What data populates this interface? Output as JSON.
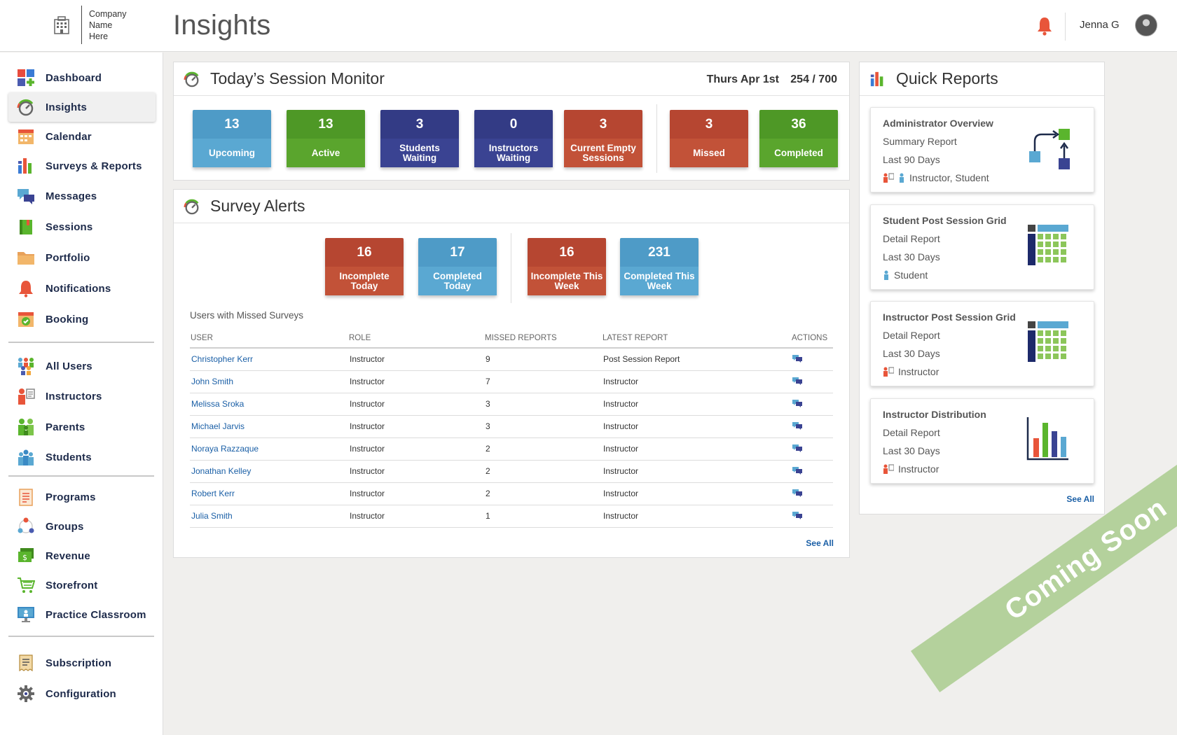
{
  "header": {
    "company_name": "Company\nName\nHere",
    "title": "Insights",
    "user_name": "Jenna G"
  },
  "sidebar": {
    "items": [
      {
        "label": "Dashboard",
        "icon": "dashboard-icon"
      },
      {
        "label": "Insights",
        "icon": "gauge-icon",
        "active": true
      },
      {
        "label": "Calendar",
        "icon": "calendar-icon"
      },
      {
        "label": "Surveys & Reports",
        "icon": "bar-chart-icon"
      },
      {
        "label": "Messages",
        "icon": "chat-icon"
      },
      {
        "label": "Sessions",
        "icon": "book-icon"
      },
      {
        "label": "Portfolio",
        "icon": "folder-icon"
      },
      {
        "label": "Notifications",
        "icon": "bell-icon"
      },
      {
        "label": "Booking",
        "icon": "calendar-check-icon"
      },
      {
        "label": "All Users",
        "icon": "users-icon"
      },
      {
        "label": "Instructors",
        "icon": "instructor-icon"
      },
      {
        "label": "Parents",
        "icon": "parents-icon"
      },
      {
        "label": "Students",
        "icon": "students-icon"
      },
      {
        "label": "Programs",
        "icon": "clipboard-icon"
      },
      {
        "label": "Groups",
        "icon": "groups-icon"
      },
      {
        "label": "Revenue",
        "icon": "money-icon"
      },
      {
        "label": "Storefront",
        "icon": "cart-icon"
      },
      {
        "label": "Practice Classroom",
        "icon": "monitor-icon"
      },
      {
        "label": "Subscription",
        "icon": "receipt-icon"
      },
      {
        "label": "Configuration",
        "icon": "gear-icon"
      }
    ]
  },
  "session_monitor": {
    "title": "Today’s Session Monitor",
    "date": "Thurs Apr 1st",
    "count": "254 / 700",
    "tiles": [
      {
        "value": "13",
        "label": "Upcoming",
        "color": "#4e9bc7"
      },
      {
        "value": "13",
        "label": "Active",
        "color": "#4e9826"
      },
      {
        "value": "3",
        "label": "Students Waiting",
        "color": "#333b85"
      },
      {
        "value": "0",
        "label": "Instructors Waiting",
        "color": "#333b85"
      },
      {
        "value": "3",
        "label": "Current Empty Sessions",
        "color": "#b64631"
      },
      {
        "value": "3",
        "label": "Missed",
        "color": "#b64631"
      },
      {
        "value": "36",
        "label": "Completed",
        "color": "#4e9826"
      }
    ]
  },
  "survey_alerts": {
    "title": "Survey Alerts",
    "tiles": [
      {
        "value": "16",
        "label": "Incomplete Today",
        "color": "#b64631"
      },
      {
        "value": "17",
        "label": "Completed Today",
        "color": "#4e9bc7"
      },
      {
        "value": "16",
        "label": "Incomplete This Week",
        "color": "#b64631"
      },
      {
        "value": "231",
        "label": "Completed This Week",
        "color": "#4e9bc7"
      }
    ],
    "subhead": "Users with Missed Surveys",
    "columns": [
      "USER",
      "ROLE",
      "MISSED REPORTS",
      "LATEST REPORT",
      "ACTIONS"
    ],
    "rows": [
      {
        "user": "Christopher Kerr",
        "role": "Instructor",
        "missed": "9",
        "latest": "Post Session Report"
      },
      {
        "user": "John Smith",
        "role": "Instructor",
        "missed": "7",
        "latest": "Instructor"
      },
      {
        "user": "Melissa Sroka",
        "role": "Instructor",
        "missed": "3",
        "latest": "Instructor"
      },
      {
        "user": "Michael Jarvis",
        "role": "Instructor",
        "missed": "3",
        "latest": "Instructor"
      },
      {
        "user": "Noraya Razzaque",
        "role": "Instructor",
        "missed": "2",
        "latest": "Instructor"
      },
      {
        "user": "Jonathan Kelley",
        "role": "Instructor",
        "missed": "2",
        "latest": "Instructor"
      },
      {
        "user": "Robert Kerr",
        "role": "Instructor",
        "missed": "2",
        "latest": "Instructor"
      },
      {
        "user": "Julia Smith",
        "role": "Instructor",
        "missed": "1",
        "latest": "Instructor"
      }
    ],
    "see_all": "See All"
  },
  "quick_reports": {
    "title": "Quick Reports",
    "cards": [
      {
        "title": "Administrator Overview",
        "type": "Summary Report",
        "range": "Last 90 Days",
        "audience": "Instructor, Student",
        "art": "flow-diagram-icon"
      },
      {
        "title": "Student Post Session Grid",
        "type": "Detail Report",
        "range": "Last 30 Days",
        "audience": "Student",
        "art": "grid-icon"
      },
      {
        "title": "Instructor Post Session Grid",
        "type": "Detail Report",
        "range": "Last 30 Days",
        "audience": "Instructor",
        "art": "grid-icon"
      },
      {
        "title": "Instructor Distribution",
        "type": "Detail Report",
        "range": "Last 30 Days",
        "audience": "Instructor",
        "art": "bar-chart-icon"
      }
    ],
    "see_all": "See All"
  },
  "ribbon": "Coming Soon"
}
